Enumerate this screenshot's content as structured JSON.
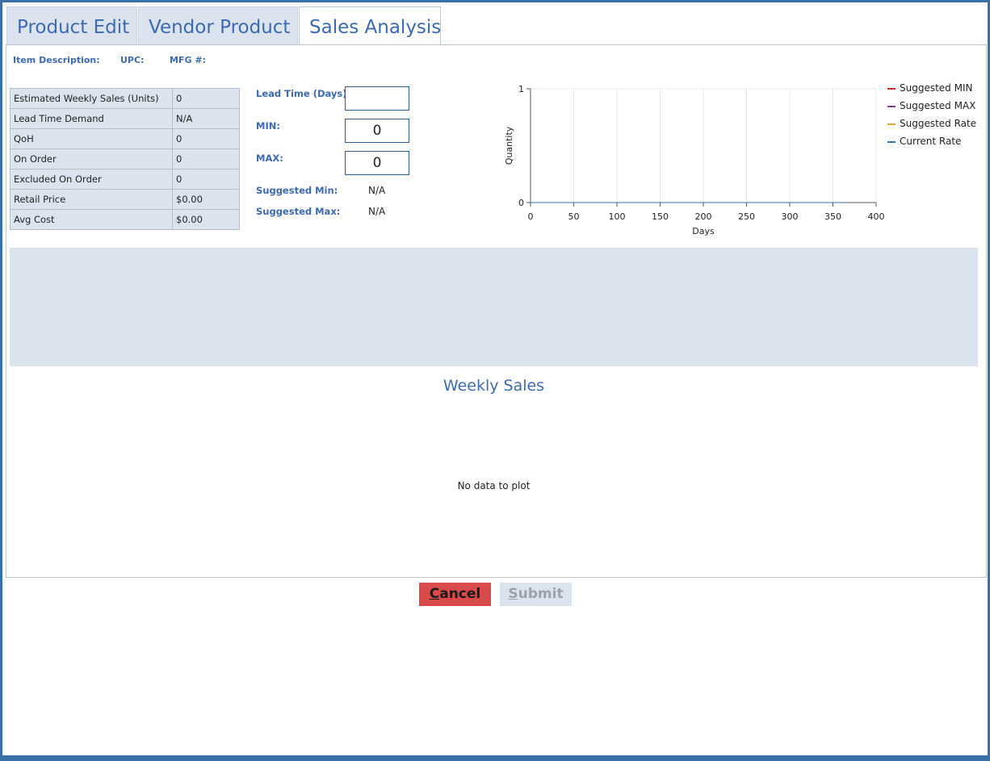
{
  "tabs": [
    {
      "label": "Product Edit"
    },
    {
      "label": "Vendor Product"
    },
    {
      "label": "Sales Analysis",
      "active": true
    }
  ],
  "item_header": {
    "description_label": "Item Description:",
    "upc_label": "UPC:",
    "mfg_label": "MFG #:"
  },
  "stats": [
    {
      "label": "Estimated Weekly Sales (Units)",
      "value": "0"
    },
    {
      "label": "Lead Time Demand",
      "value": "N/A"
    },
    {
      "label": "QoH",
      "value": "0"
    },
    {
      "label": "On Order",
      "value": "0"
    },
    {
      "label": "Excluded On Order",
      "value": "0"
    },
    {
      "label": "Retail Price",
      "value": "$0.00"
    },
    {
      "label": "Avg Cost",
      "value": "$0.00"
    }
  ],
  "params": {
    "lead_time_label": "Lead Time (Days):",
    "lead_time_value": "",
    "min_label": "MIN:",
    "min_value": "0",
    "max_label": "MAX:",
    "max_value": "0",
    "suggested_min_label": "Suggested Min:",
    "suggested_min_value": "N/A",
    "suggested_max_label": "Suggested Max:",
    "suggested_max_value": "N/A"
  },
  "chart_data": {
    "type": "line",
    "xlabel": "Days",
    "ylabel": "Quantity",
    "xlim": [
      0,
      400
    ],
    "ylim": [
      0,
      1
    ],
    "xticks": [
      0,
      50,
      100,
      150,
      200,
      250,
      300,
      350,
      400
    ],
    "yticks": [
      0,
      1
    ],
    "grid": "vertical",
    "legend_position": "right",
    "series": [
      {
        "name": "Suggested MIN",
        "color": "#cc2a2a",
        "x": [
          0,
          365
        ],
        "y": [
          0,
          0
        ]
      },
      {
        "name": "Suggested MAX",
        "color": "#7a3a8c",
        "x": [
          0,
          365
        ],
        "y": [
          0,
          0
        ]
      },
      {
        "name": "Suggested Rate",
        "color": "#e8a33c",
        "x": [
          0,
          365
        ],
        "y": [
          0,
          0
        ]
      },
      {
        "name": "Current Rate",
        "color": "#3a6fa8",
        "x": [
          0,
          365
        ],
        "y": [
          0,
          0
        ]
      }
    ]
  },
  "weekly_sales": {
    "title": "Weekly Sales",
    "empty_text": "No data to plot"
  },
  "buttons": {
    "cancel_first": "C",
    "cancel_rest": "ancel",
    "submit_first": "S",
    "submit_rest": "ubmit"
  },
  "colors": {
    "accent": "#3c6ab0",
    "frame": "#3a6fa8",
    "panel": "#dbe4ee",
    "cancel": "#d94b4b"
  }
}
